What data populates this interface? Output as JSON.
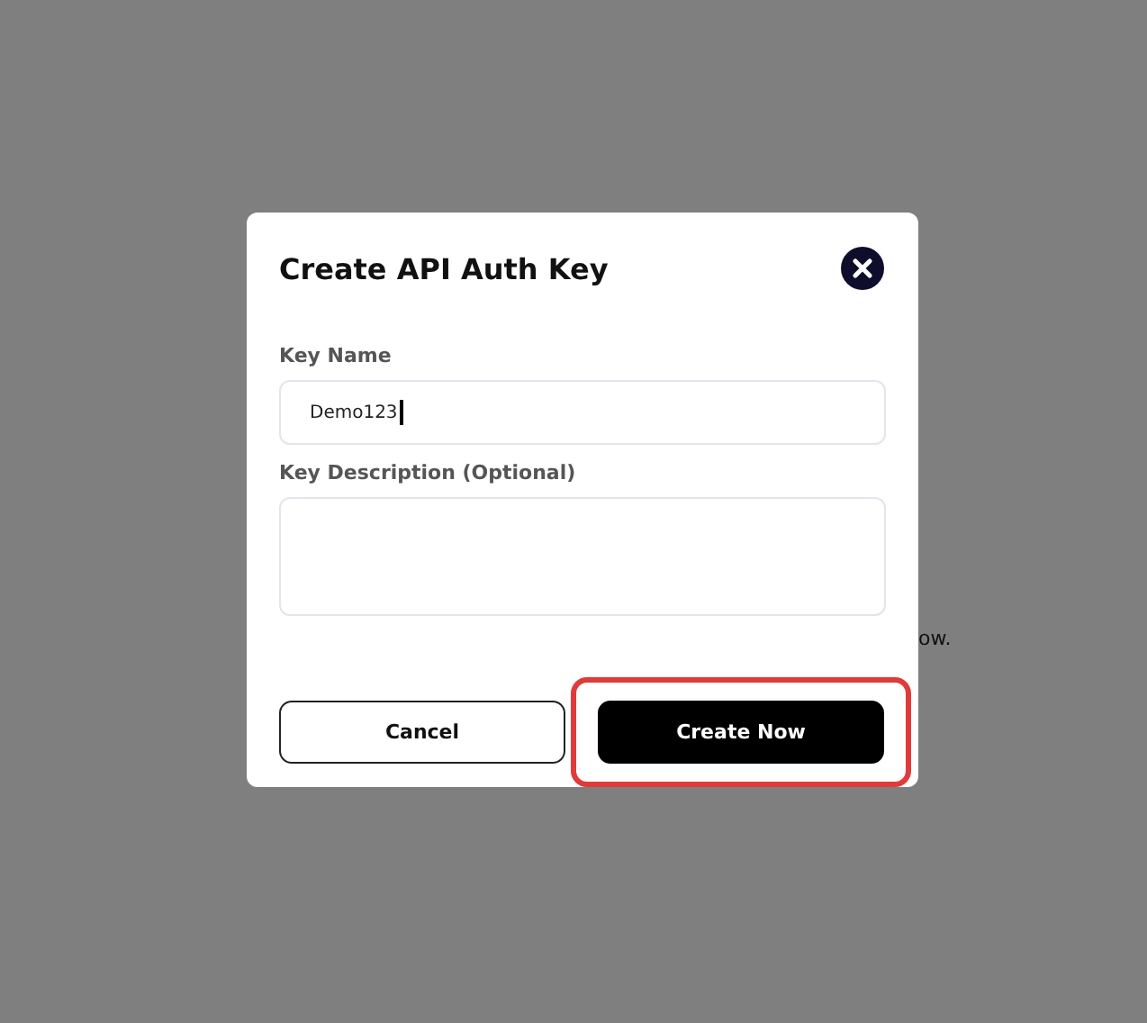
{
  "background_text": "ow.",
  "dialog": {
    "title": "Create API Auth Key",
    "fields": [
      {
        "kind": "input",
        "label": "Key Name",
        "value": "Demo123",
        "focused": true
      },
      {
        "kind": "textarea",
        "label": "Key Description (Optional)",
        "focused": false
      }
    ],
    "buttons": [
      {
        "label": "Cancel",
        "kind": "secondary",
        "highlighted": false
      },
      {
        "label": "Create Now",
        "kind": "primary",
        "highlighted": true
      }
    ]
  }
}
